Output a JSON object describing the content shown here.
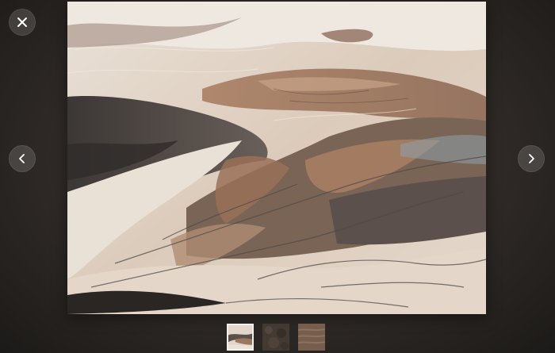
{
  "viewer": {
    "close": {
      "icon": "close-icon"
    },
    "prev": {
      "icon": "chevron-left-icon"
    },
    "next": {
      "icon": "chevron-right-icon"
    }
  },
  "image": {
    "subject": "aerial-braided-riverbed-photo"
  },
  "thumbnails": [
    {
      "id": "thumb-1",
      "active": true
    },
    {
      "id": "thumb-2",
      "active": false
    },
    {
      "id": "thumb-3",
      "active": false
    }
  ],
  "colors": {
    "backdrop": "#2f2a27",
    "button_bg": "rgba(255,255,255,0.14)",
    "icon": "#ffffff",
    "active_border": "#f2f0ec"
  }
}
